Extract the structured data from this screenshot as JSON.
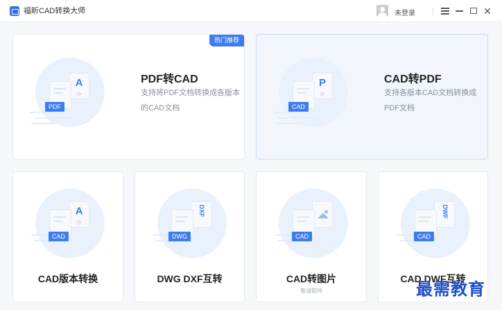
{
  "app": {
    "title": "福昕CAD转换大师"
  },
  "header": {
    "login_text": "未登录"
  },
  "cards": {
    "pdf_to_cad": {
      "badge": "热门推荐",
      "title": "PDF转CAD",
      "desc": "支持将PDF文档转换成各版本的CAD文档",
      "tag": "PDF",
      "letter": "A"
    },
    "cad_to_pdf": {
      "title": "CAD转PDF",
      "desc": "支持各版本CAD文档转换成PDF文档",
      "tag": "CAD",
      "letter": "P"
    },
    "cad_version": {
      "title": "CAD版本转换",
      "tag": "CAD",
      "letter": "A"
    },
    "dwg_dxf": {
      "title": "DWG DXF互转",
      "tag": "DWG",
      "vtext": "DXF"
    },
    "cad_to_image": {
      "title": "CAD转图片",
      "subtitle": "敬请期待",
      "tag": "CAD"
    },
    "cad_dwf": {
      "title": "CAD DWF互转",
      "tag": "CAD",
      "vtext": "DWF"
    }
  },
  "watermark": "最需教育",
  "colors": {
    "accent": "#3d7cf0",
    "illustration_bg": "#e9f1fc",
    "active_card_bg": "#f2f6fc"
  },
  "icons": [
    "app-logo-icon",
    "user-avatar-icon",
    "menu-icon",
    "minimize-icon",
    "maximize-icon",
    "close-icon",
    "sync-icon",
    "image-icon"
  ]
}
